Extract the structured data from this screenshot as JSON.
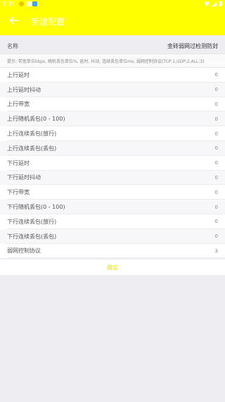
{
  "status_bar": {
    "time": "3:35",
    "right_icons": [
      "wifi-icon",
      "signal-icon",
      "battery-icon"
    ]
  },
  "app_bar": {
    "title": "新建配置",
    "back_icon": "arrow-left-icon"
  },
  "name_row": {
    "label": "名称",
    "value": "金砖弱网过检测防封"
  },
  "hint": "提示: 带宽单位kbps, 随机丢包单位%, 延时, 抖动, 连续丢包单位ms, 弱网控制协议(TCP:1,UDP:2,ALL:3)",
  "rows": [
    {
      "label": "上行延时",
      "value": "0"
    },
    {
      "label": "上行延时抖动",
      "value": "0"
    },
    {
      "label": "上行带宽",
      "value": "0"
    },
    {
      "label": "上行随机丢包(0 - 100)",
      "value": "0"
    },
    {
      "label": "上行连续丢包(放行)",
      "value": "0"
    },
    {
      "label": "上行连续丢包(丢包)",
      "value": "0"
    },
    {
      "label": "下行延时",
      "value": "0"
    },
    {
      "label": "下行延时抖动",
      "value": "0"
    },
    {
      "label": "下行带宽",
      "value": "0"
    },
    {
      "label": "下行随机丢包(0 - 100)",
      "value": "0"
    },
    {
      "label": "下行连续丢包(放行)",
      "value": "0"
    },
    {
      "label": "下行连续丢包(丢包)",
      "value": "0"
    },
    {
      "label": "弱网控制协议",
      "value": "3"
    }
  ],
  "confirm_label": "确定",
  "colors": {
    "accent": "#ffff00",
    "background": "#eeeef2"
  }
}
